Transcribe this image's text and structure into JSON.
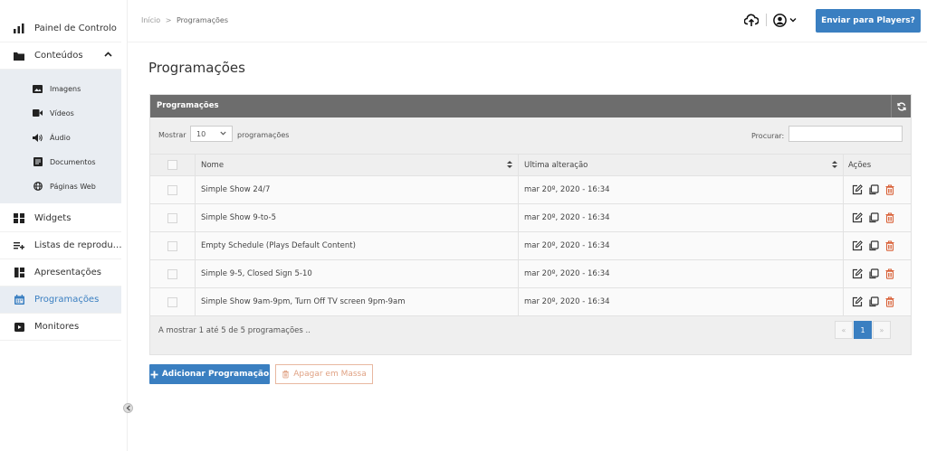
{
  "sidebar": {
    "items": [
      {
        "label": "Painel de Controlo",
        "icon": "bar-chart-icon"
      },
      {
        "label": "Conteúdos",
        "icon": "folder-icon"
      },
      {
        "label": "Widgets",
        "icon": "widgets-icon"
      },
      {
        "label": "Listas de reprodu…",
        "icon": "playlist-icon"
      },
      {
        "label": "Apresentações",
        "icon": "layout-icon"
      },
      {
        "label": "Programações",
        "icon": "calendar-icon"
      },
      {
        "label": "Monitores",
        "icon": "monitor-icon"
      }
    ],
    "sub_items": [
      {
        "label": "Imagens",
        "icon": "image-icon"
      },
      {
        "label": "Vídeos",
        "icon": "video-icon"
      },
      {
        "label": "Áudio",
        "icon": "audio-icon"
      },
      {
        "label": "Documentos",
        "icon": "document-icon"
      },
      {
        "label": "Páginas Web",
        "icon": "globe-icon"
      }
    ]
  },
  "header": {
    "breadcrumb_root": "Início",
    "breadcrumb_sep": ">",
    "breadcrumb_current": "Programações",
    "send_button": "Enviar para Players?"
  },
  "page": {
    "title": "Programações"
  },
  "panel": {
    "title": "Programações",
    "show_label": "Mostrar",
    "show_value": "10",
    "show_after": "programações",
    "search_label": "Procurar:",
    "search_value": "",
    "columns": {
      "name": "Nome",
      "date": "Ultima alteração",
      "actions": "Ações"
    },
    "rows": [
      {
        "name": "Simple Show 24/7",
        "date": "mar 20º, 2020 - 16:34"
      },
      {
        "name": "Simple Show 9-to-5",
        "date": "mar 20º, 2020 - 16:34"
      },
      {
        "name": "Empty Schedule (Plays Default Content)",
        "date": "mar 20º, 2020 - 16:34"
      },
      {
        "name": "Simple 9-5, Closed Sign 5-10",
        "date": "mar 20º, 2020 - 16:34"
      },
      {
        "name": "Simple Show 9am-9pm, Turn Off TV screen 9pm-9am",
        "date": "mar 20º, 2020 - 16:34"
      }
    ],
    "footer": "A mostrar 1 até 5 de 5 programações ..",
    "pager": {
      "prev": "«",
      "current": "1",
      "next": "»"
    }
  },
  "actions": {
    "add": "Adicionar Programação",
    "bulk_delete": "Apagar em Massa"
  },
  "colors": {
    "accent": "#3a7fc1",
    "panel_header": "#6d6d6d",
    "danger_icon": "#d9633a"
  }
}
